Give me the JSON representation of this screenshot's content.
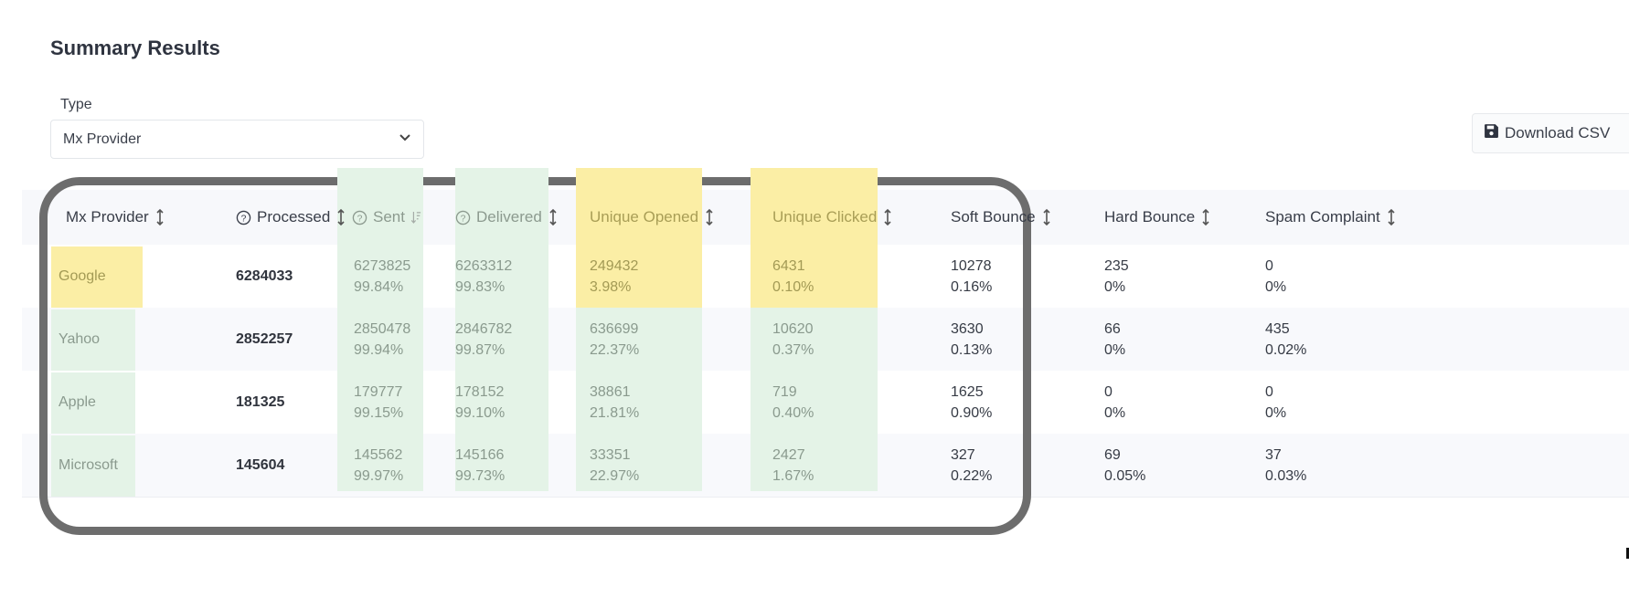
{
  "page": {
    "title": "Summary Results"
  },
  "filter": {
    "type_label": "Type",
    "type_value": "Mx Provider",
    "type_icon": "chevron-down-icon"
  },
  "toolbar": {
    "download_label": "Download CSV",
    "download_icon": "floppy-disk-icon"
  },
  "table": {
    "columns": [
      {
        "label": "Mx Provider",
        "help_icon": false,
        "sort": "sortable"
      },
      {
        "label": "Processed",
        "help_icon": true,
        "sort": "sortable"
      },
      {
        "label": "Sent",
        "help_icon": true,
        "sort": "sorted-desc"
      },
      {
        "label": "Delivered",
        "help_icon": true,
        "sort": "sortable"
      },
      {
        "label": "Unique Opened",
        "help_icon": false,
        "sort": "sortable"
      },
      {
        "label": "Unique Clicked",
        "help_icon": false,
        "sort": "sortable"
      },
      {
        "label": "Soft Bounce",
        "help_icon": false,
        "sort": "sortable"
      },
      {
        "label": "Hard Bounce",
        "help_icon": false,
        "sort": "sortable"
      },
      {
        "label": "Spam Complaint",
        "help_icon": false,
        "sort": "sortable"
      }
    ],
    "rows": [
      {
        "provider": "Google",
        "provider_highlight": "yellow",
        "processed": "6284033",
        "sent": {
          "count": "6273825",
          "pct": "99.84%"
        },
        "delivered": {
          "count": "6263312",
          "pct": "99.83%"
        },
        "unique_opened": {
          "count": "249432",
          "pct": "3.98%",
          "highlight": "yellow"
        },
        "unique_clicked": {
          "count": "6431",
          "pct": "0.10%",
          "highlight": "yellow"
        },
        "soft_bounce": {
          "count": "10278",
          "pct": "0.16%"
        },
        "hard_bounce": {
          "count": "235",
          "pct": "0%"
        },
        "spam_complaint": {
          "count": "0",
          "pct": "0%"
        }
      },
      {
        "provider": "Yahoo",
        "provider_highlight": "green",
        "processed": "2852257",
        "sent": {
          "count": "2850478",
          "pct": "99.94%"
        },
        "delivered": {
          "count": "2846782",
          "pct": "99.87%"
        },
        "unique_opened": {
          "count": "636699",
          "pct": "22.37%",
          "highlight": "green"
        },
        "unique_clicked": {
          "count": "10620",
          "pct": "0.37%",
          "highlight": "green"
        },
        "soft_bounce": {
          "count": "3630",
          "pct": "0.13%"
        },
        "hard_bounce": {
          "count": "66",
          "pct": "0%"
        },
        "spam_complaint": {
          "count": "435",
          "pct": "0.02%"
        }
      },
      {
        "provider": "Apple",
        "provider_highlight": "green",
        "processed": "181325",
        "sent": {
          "count": "179777",
          "pct": "99.15%"
        },
        "delivered": {
          "count": "178152",
          "pct": "99.10%"
        },
        "unique_opened": {
          "count": "38861",
          "pct": "21.81%",
          "highlight": "green"
        },
        "unique_clicked": {
          "count": "719",
          "pct": "0.40%",
          "highlight": "green"
        },
        "soft_bounce": {
          "count": "1625",
          "pct": "0.90%"
        },
        "hard_bounce": {
          "count": "0",
          "pct": "0%"
        },
        "spam_complaint": {
          "count": "0",
          "pct": "0%"
        }
      },
      {
        "provider": "Microsoft",
        "provider_highlight": "green",
        "processed": "145604",
        "sent": {
          "count": "145562",
          "pct": "99.97%"
        },
        "delivered": {
          "count": "145166",
          "pct": "99.73%"
        },
        "unique_opened": {
          "count": "33351",
          "pct": "22.97%",
          "highlight": "green"
        },
        "unique_clicked": {
          "count": "2427",
          "pct": "1.67%",
          "highlight": "green"
        },
        "soft_bounce": {
          "count": "327",
          "pct": "0.22%"
        },
        "hard_bounce": {
          "count": "69",
          "pct": "0.05%"
        },
        "spam_complaint": {
          "count": "37",
          "pct": "0.03%"
        }
      }
    ]
  },
  "colors": {
    "highlight_yellow": "#fbeea5",
    "highlight_green": "#e4f3e7",
    "annotation_outline": "#6d6d6d"
  }
}
